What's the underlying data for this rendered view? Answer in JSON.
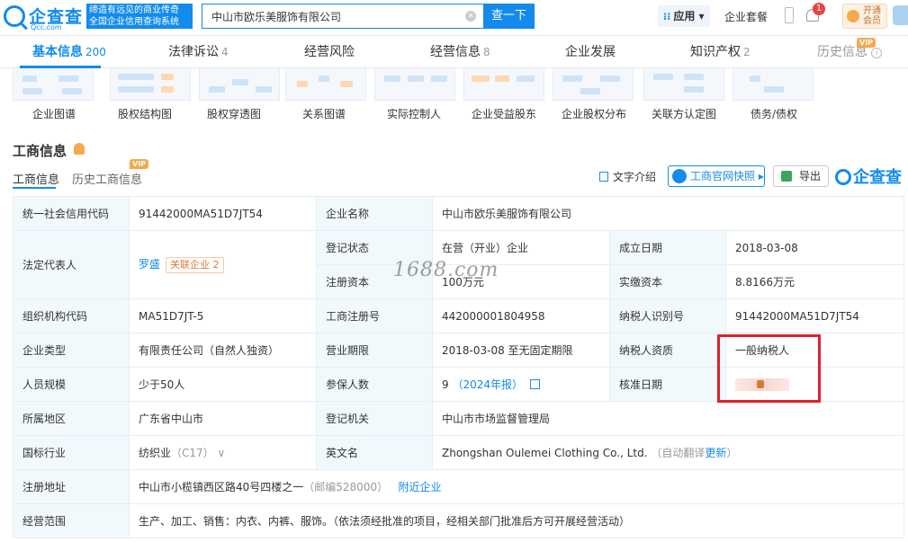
{
  "header": {
    "logo_text": "企查查",
    "logo_url": "Qcc.com",
    "slogan_line1": "缔造有远见的商业传奇",
    "slogan_line2": "全国企业信用查询系统",
    "search_value": "中山市欧乐美服饰有限公司",
    "search_button": "查一下",
    "app_label": "应用",
    "package_label": "企业套餐",
    "notification_count": "1",
    "vip_label": "开通会员"
  },
  "tabs": [
    {
      "label": "基本信息",
      "count": "200"
    },
    {
      "label": "法律诉讼",
      "count": "4"
    },
    {
      "label": "经营风险",
      "count": ""
    },
    {
      "label": "经营信息",
      "count": "8"
    },
    {
      "label": "企业发展",
      "count": ""
    },
    {
      "label": "知识产权",
      "count": "2"
    },
    {
      "label": "历史信息",
      "count": "",
      "vip": "VIP"
    }
  ],
  "graphs": [
    "企业图谱",
    "股权结构图",
    "股权穿透图",
    "关系图谱",
    "实际控制人",
    "企业受益股东",
    "企业股权分布",
    "关联方认定图",
    "债务/债权"
  ],
  "section": {
    "title": "工商信息",
    "subtab_active": "工商信息",
    "subtab_history": "历史工商信息",
    "subtab_history_vip": "VIP",
    "intro_label": "文字介绍",
    "snapshot_label": "工商官网快照",
    "export_label": "导出",
    "brand": "企查查"
  },
  "info": {
    "credit_code_k": "统一社会信用代码",
    "credit_code": "91442000MA51D7JT54",
    "company_name_k": "企业名称",
    "company_name": "中山市欧乐美服饰有限公司",
    "legal_rep_k": "法定代表人",
    "legal_rep": "罗盛",
    "related_label": "关联企业",
    "related_count": "2",
    "status_k": "登记状态",
    "status": "在营（开业）企业",
    "found_date_k": "成立日期",
    "found_date": "2018-03-08",
    "reg_capital_k": "注册资本",
    "reg_capital": "100万元",
    "paid_capital_k": "实缴资本",
    "paid_capital": "8.8166万元",
    "org_code_k": "组织机构代码",
    "org_code": "MA51D7JT-5",
    "reg_no_k": "工商注册号",
    "reg_no": "442000001804958",
    "taxpayer_id_k": "纳税人识别号",
    "taxpayer_id": "91442000MA51D7JT54",
    "company_type_k": "企业类型",
    "company_type": "有限责任公司（自然人独资）",
    "biz_term_k": "营业期限",
    "biz_term": "2018-03-08 至无固定期限",
    "taxpayer_qual_k": "纳税人资质",
    "taxpayer_qual": "一般纳税人",
    "staff_k": "人员规模",
    "staff": "少于50人",
    "insured_k": "参保人数",
    "insured_num": "9",
    "insured_year": "（2024年报）",
    "approve_date_k": "核准日期",
    "region_k": "所属地区",
    "region": "广东省中山市",
    "authority_k": "登记机关",
    "authority": "中山市市场监督管理局",
    "industry_k": "国标行业",
    "industry": "纺织业",
    "industry_code": "（C17）",
    "english_name_k": "英文名",
    "english_name": "Zhongshan Oulemei Clothing Co., Ltd.",
    "english_note": "（自动翻译",
    "english_update": "更新",
    "english_close": "）",
    "address_k": "注册地址",
    "address": "中山市小榄镇西区路40号四楼之一",
    "postcode": "（邮编528000）",
    "nearby": "附近企业",
    "scope_k": "经营范围",
    "scope": "生产、加工、销售：内衣、内裤、服饰。（依法须经批准的项目，经相关部门批准后方可开展经营活动）"
  },
  "watermark": "1688.com",
  "colors": {
    "brand": "#128bed",
    "highlight_box": "#e0202a",
    "key_cell_bg": "#f2f9fc"
  }
}
